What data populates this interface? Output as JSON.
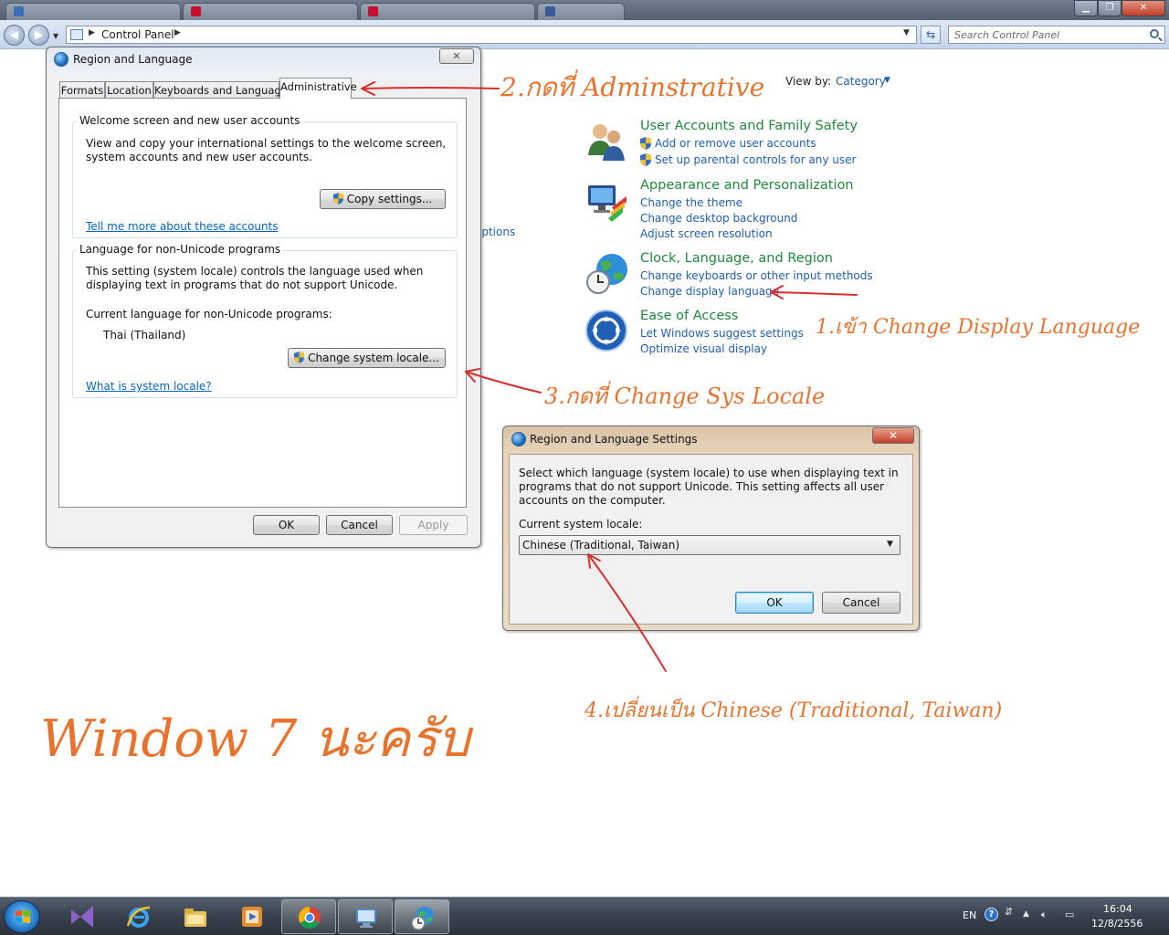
{
  "browser": {
    "tabs": [
      "",
      "",
      "",
      ""
    ],
    "address": "Control Panel",
    "search_placeholder": "Search Control Panel"
  },
  "control_panel": {
    "view_by_label": "View by:",
    "view_by_value": "Category",
    "options_fragment": "options",
    "categories": [
      {
        "title": "User Accounts and Family Safety",
        "links": [
          "Add or remove user accounts",
          "Set up parental controls for any user"
        ]
      },
      {
        "title": "Appearance and Personalization",
        "links": [
          "Change the theme",
          "Change desktop background",
          "Adjust screen resolution"
        ]
      },
      {
        "title": "Clock, Language, and Region",
        "links": [
          "Change keyboards or other input methods",
          "Change display language"
        ]
      },
      {
        "title": "Ease of Access",
        "links": [
          "Let Windows suggest settings",
          "Optimize visual display"
        ]
      }
    ]
  },
  "region_dialog": {
    "title": "Region and Language",
    "close_label": "✕",
    "tabs": [
      "Formats",
      "Location",
      "Keyboards and Languages",
      "Administrative"
    ],
    "welcome": {
      "heading": "Welcome screen and new user accounts",
      "description": "View and copy your international settings to the welcome screen, system accounts and new user accounts.",
      "copy_button": "Copy settings...",
      "link": "Tell me more about these accounts"
    },
    "unicode": {
      "heading": "Language for non-Unicode programs",
      "description": "This setting (system locale) controls the language used when displaying text in programs that do not support Unicode.",
      "current_label": "Current language for non-Unicode programs:",
      "current_value": "Thai (Thailand)",
      "change_button": "Change system locale...",
      "link": "What is system locale?"
    },
    "buttons": {
      "ok": "OK",
      "cancel": "Cancel",
      "apply": "Apply"
    }
  },
  "locale_dialog": {
    "title": "Region and Language Settings",
    "close_label": "✕",
    "description": "Select which language (system locale) to use when displaying text in programs that do not support Unicode. This setting affects all user accounts on the computer.",
    "locale_label": "Current system locale:",
    "locale_value": "Chinese (Traditional, Taiwan)",
    "ok": "OK",
    "cancel": "Cancel"
  },
  "annotations": {
    "step1": "1.เข้า Change Display Language",
    "step2": "2.กดที่ Adminstrative",
    "step3": "3.กดที่ Change Sys Locale",
    "step4": "4.เปลี่ยนเป็น Chinese (Traditional, Taiwan)",
    "caption": "Window 7 นะครับ",
    "color": "#e8732c"
  },
  "taskbar": {
    "apps": [
      "visual-studio-icon",
      "internet-explorer-icon",
      "windows-explorer-icon",
      "media-player-icon",
      "chrome-icon",
      "remote-desktop-icon",
      "region-globe-icon"
    ],
    "lang": "EN",
    "time": "16:04",
    "date": "12/8/2556"
  }
}
